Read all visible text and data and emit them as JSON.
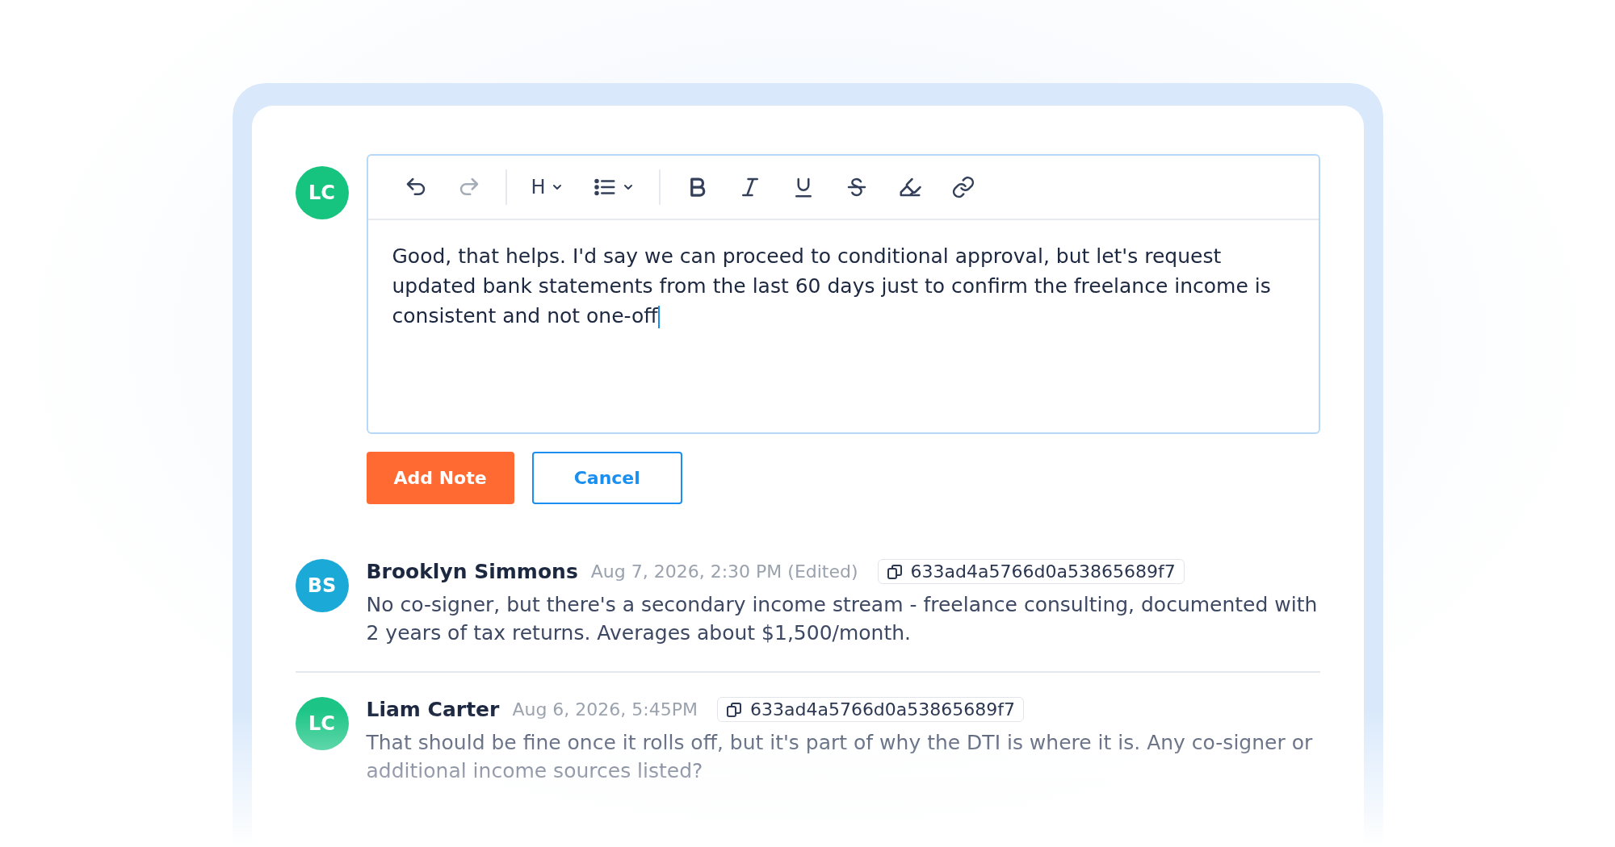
{
  "composer": {
    "avatar": {
      "initials": "LC",
      "color": "#16c47f"
    },
    "toolbar": [
      [
        {
          "kind": "undo",
          "disabled": false
        },
        {
          "kind": "redo",
          "disabled": true
        }
      ],
      [
        {
          "kind": "heading",
          "label": "H",
          "disabled": false
        },
        {
          "kind": "list",
          "disabled": false
        }
      ],
      [
        {
          "kind": "bold",
          "disabled": false
        },
        {
          "kind": "italic",
          "disabled": false
        },
        {
          "kind": "underline",
          "disabled": false
        },
        {
          "kind": "strike",
          "disabled": false
        },
        {
          "kind": "highlight",
          "disabled": false
        },
        {
          "kind": "link",
          "disabled": false
        }
      ]
    ],
    "value": "Good, that helps. I'd say we can proceed to conditional approval, but let's request updated bank statements from the last 60 days just to confirm the freelance income is consistent and not one-off",
    "buttons": [
      {
        "label": "Add Note",
        "kind": "primary"
      },
      {
        "label": "Cancel",
        "kind": "secondary"
      }
    ]
  },
  "comments": [
    {
      "initials": "BS",
      "color": "#1ba9d8",
      "author": "Brooklyn Simmons",
      "timestamp": "Aug 7, 2026, 2:30 PM (Edited)",
      "id": "633ad4a5766d0a53865689f7",
      "body": "No co-signer, but there's a secondary income stream - freelance consulting, documented with 2 years of tax returns. Averages about $1,500/month."
    },
    {
      "initials": "LC",
      "color": "#1cc586",
      "author": "Liam Carter",
      "timestamp": "Aug 6, 2026, 5:45PM",
      "id": "633ad4a5766d0a53865689f7",
      "body": "That should be fine once it rolls off, but it's part of why the DTI is where it is. Any co-signer or additional income sources listed?"
    }
  ]
}
